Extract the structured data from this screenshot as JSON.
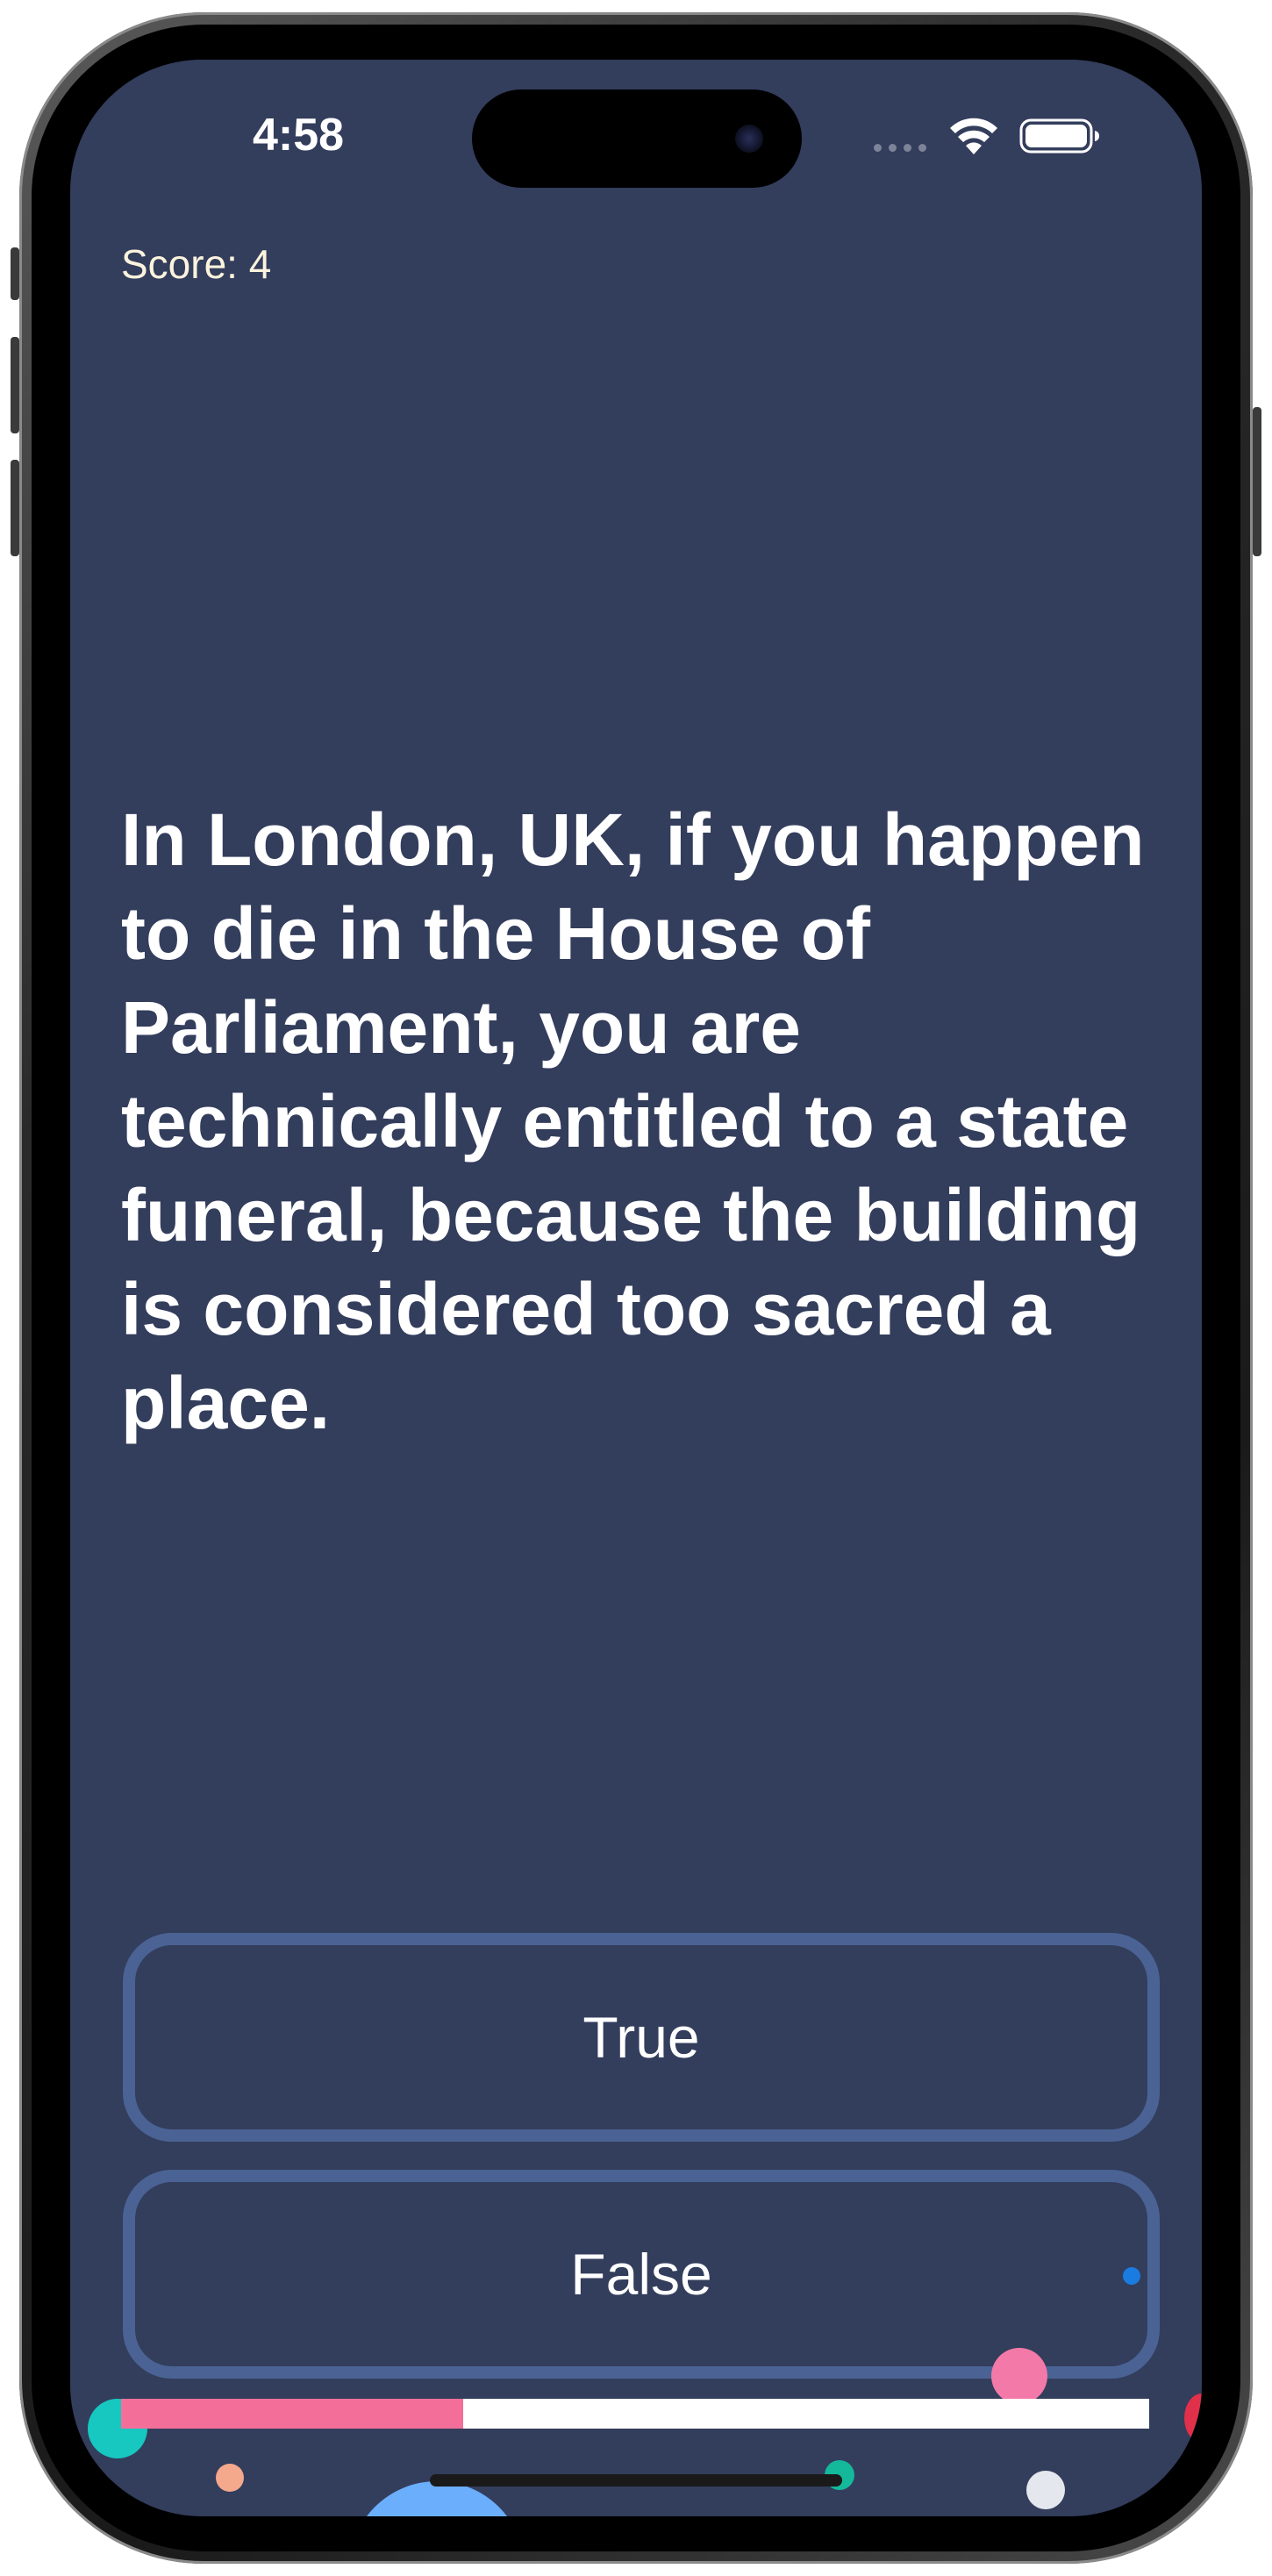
{
  "status_bar": {
    "time": "4:58"
  },
  "game": {
    "score_text": "Score: 4",
    "question": "In London, UK, if you happen to die in the House of Parliament, you are technically entitled to a state funeral, because the building is considered too sacred a place.",
    "answers": {
      "true_label": "True",
      "false_label": "False"
    },
    "progress_fraction": 0.333
  },
  "colors": {
    "background": "#333d5c",
    "button_border": "#4a6394",
    "score_text": "#fbf3dd",
    "progress_fill": "#f36f9a",
    "progress_track": "#ffffff"
  },
  "icons": [
    "wifi-icon",
    "battery-icon",
    "cellular-signal-icon"
  ]
}
